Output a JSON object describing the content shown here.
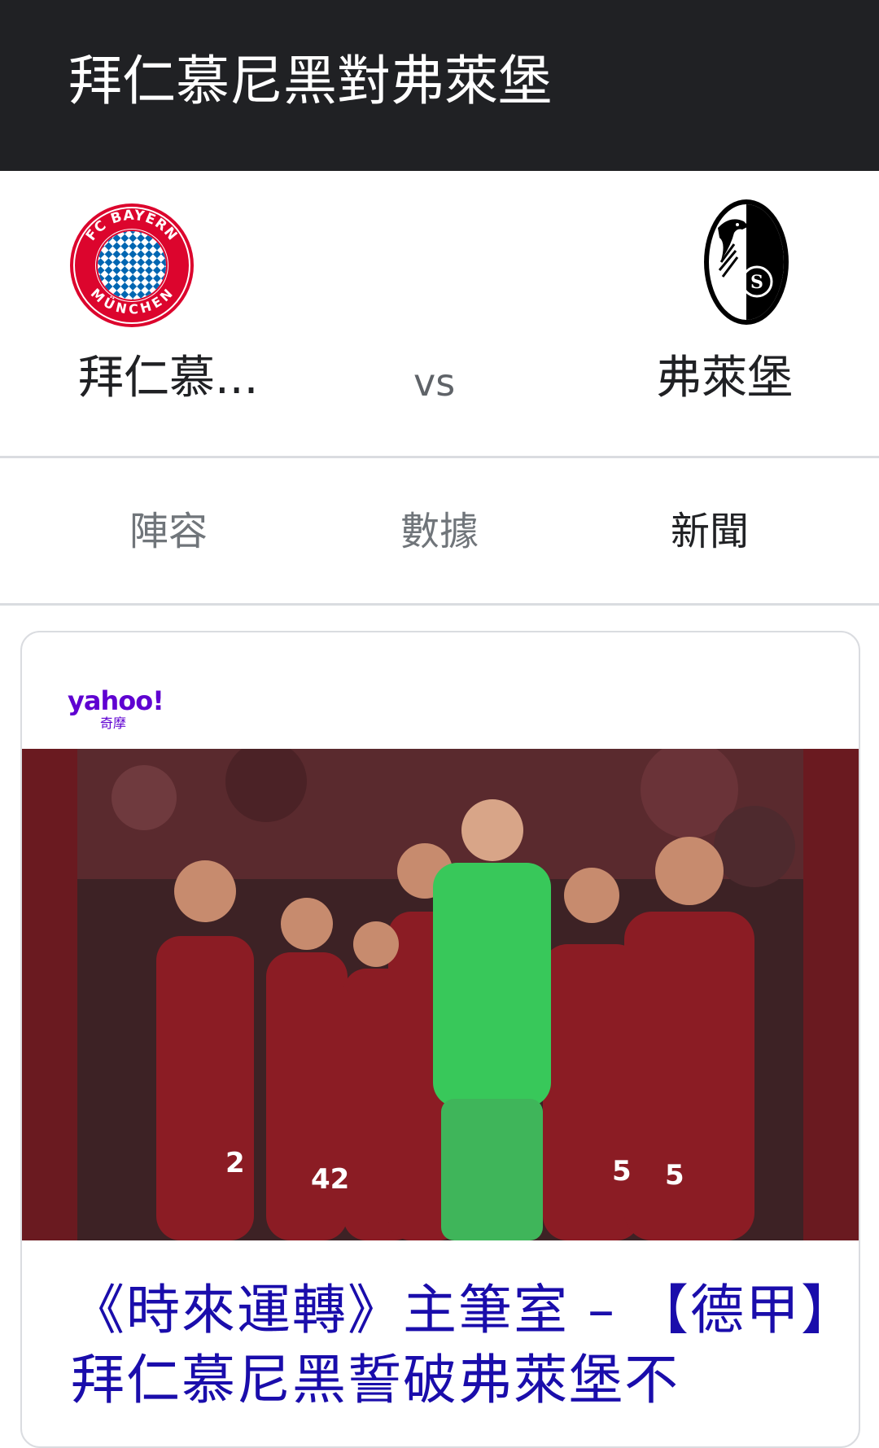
{
  "header": {
    "title": "拜仁慕尼黑對弗萊堡"
  },
  "match": {
    "home_team": "拜仁慕...",
    "away_team": "弗萊堡",
    "vs_label": "vs",
    "home_logo_icon": "fc-bayern-munchen-logo",
    "away_logo_icon": "sc-freiburg-logo",
    "home_logo_text_top": "FC BAYERN",
    "home_logo_text_bottom": "MÜNCHEN"
  },
  "tabs": [
    {
      "label": "陣容",
      "active": false
    },
    {
      "label": "數據",
      "active": false
    },
    {
      "label": "新聞",
      "active": true
    }
  ],
  "news": {
    "source_name": "yahoo!",
    "source_sub": "奇摩",
    "headline": "《時來運轉》主筆室 – 【德甲】拜仁慕尼黑誓破弗萊堡不",
    "image_icon": "bayern-players-celebrating-photo"
  },
  "colors": {
    "header_bg": "#202124",
    "link": "#1a0dab",
    "yahoo_purple": "#5f01d1",
    "bayern_red": "#dc052d",
    "bayern_blue": "#0066b2"
  }
}
